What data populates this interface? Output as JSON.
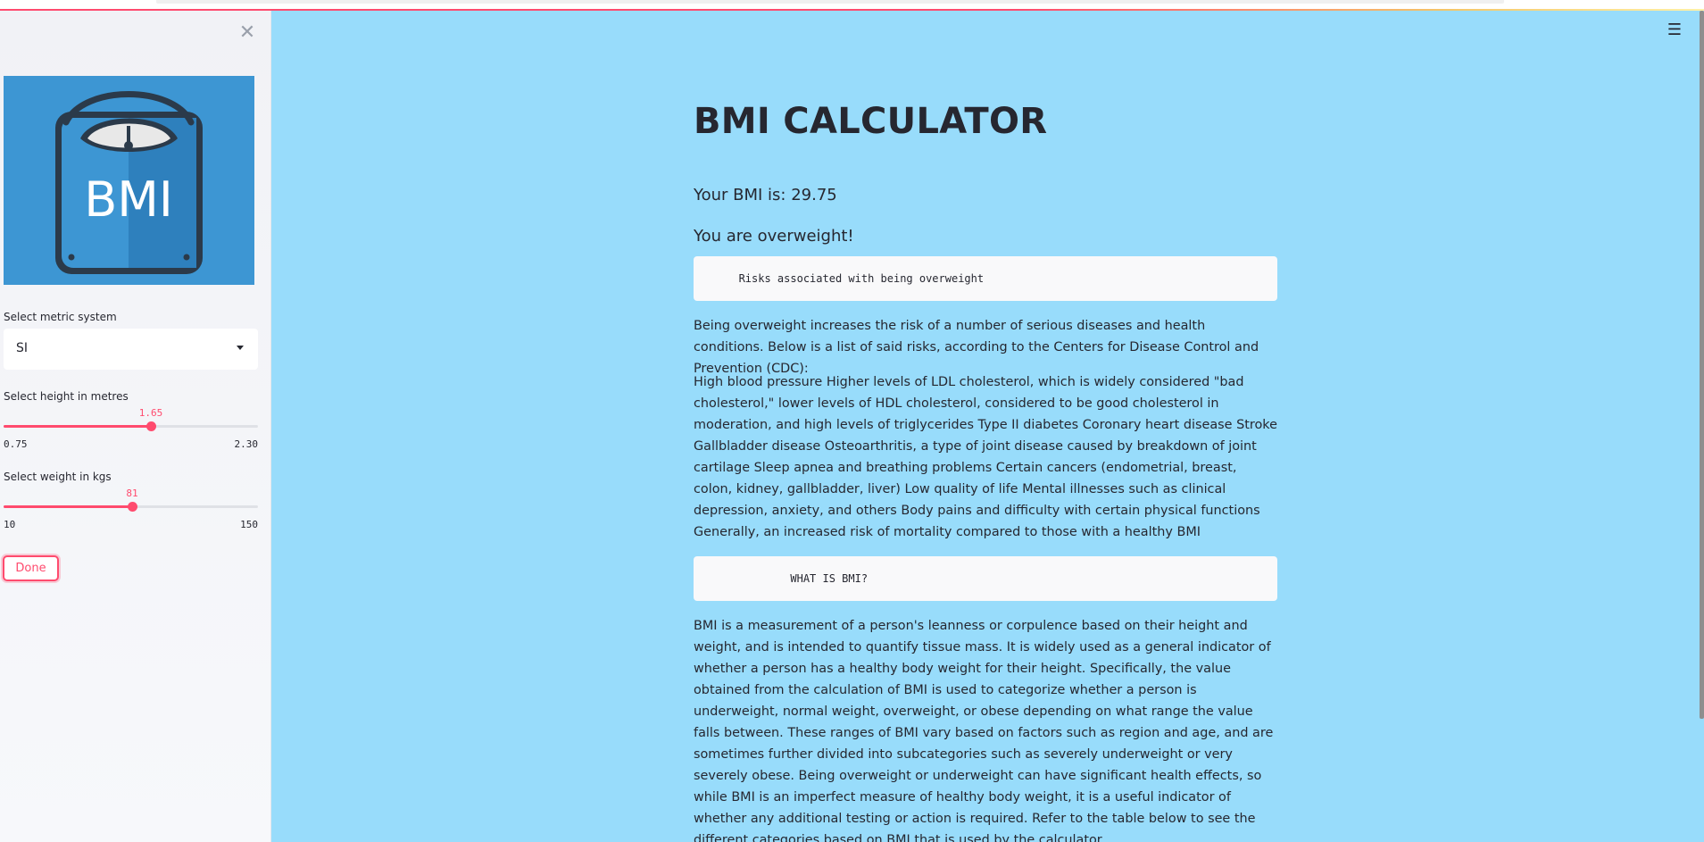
{
  "sidebar": {
    "logo_text": "BMI",
    "metric_label": "Select metric system",
    "metric_value": "SI",
    "height_slider": {
      "label": "Select height in metres",
      "value": "1.65",
      "min": "0.75",
      "max": "2.30",
      "fraction": 0.58
    },
    "weight_slider": {
      "label": "Select weight in kgs",
      "value": "81",
      "min": "10",
      "max": "150",
      "fraction": 0.507
    },
    "done_label": "Done"
  },
  "main": {
    "title": "BMI CALCULATOR",
    "bmi_result": "Your BMI is: 29.75",
    "status": "You are overweight!",
    "risks_heading": "       Risks associated with being overweight",
    "risks_intro": "Being overweight increases the risk of a number of serious diseases and health conditions. Below is a list of said risks, according to the Centers for Disease Control and Prevention (CDC):",
    "risks_list": "High blood pressure Higher levels of LDL cholesterol, which is widely considered \"bad cholesterol,\" lower levels of HDL cholesterol, considered to be good cholesterol in moderation, and high levels of triglycerides Type II diabetes Coronary heart disease Stroke Gallbladder disease Osteoarthritis, a type of joint disease caused by breakdown of joint cartilage Sleep apnea and breathing problems Certain cancers (endometrial, breast, colon, kidney, gallbladder, liver) Low quality of life Mental illnesses such as clinical depression, anxiety, and others Body pains and difficulty with certain physical functions Generally, an increased risk of mortality compared to those with a healthy BMI",
    "what_heading": "               WHAT IS BMI?",
    "what_text": "BMI is a measurement of a person's leanness or corpulence based on their height and weight, and is intended to quantify tissue mass. It is widely used as a general indicator of whether a person has a healthy body weight for their height. Specifically, the value obtained from the calculation of BMI is used to categorize whether a person is underweight, normal weight, overweight, or obese depending on what range the value falls between. These ranges of BMI vary based on factors such as region and age, and are sometimes further divided into subcategories such as severely underweight or very severely obese. Being overweight or underweight can have significant health effects, so while BMI is an imperfect measure of healthy body weight, it is a useful indicator of whether any additional testing or action is required. Refer to the table below to see the different categories based on BMI that is used by the calculator."
  },
  "icons": {
    "close": "close-icon",
    "menu": "hamburger-menu-icon",
    "caret": "chevron-down-icon"
  },
  "colors": {
    "accent": "#ff4b6e",
    "main_bg": "#98dcfb",
    "sidebar_bg": "#f4f5f9",
    "logo_bg": "#3d96d3"
  }
}
